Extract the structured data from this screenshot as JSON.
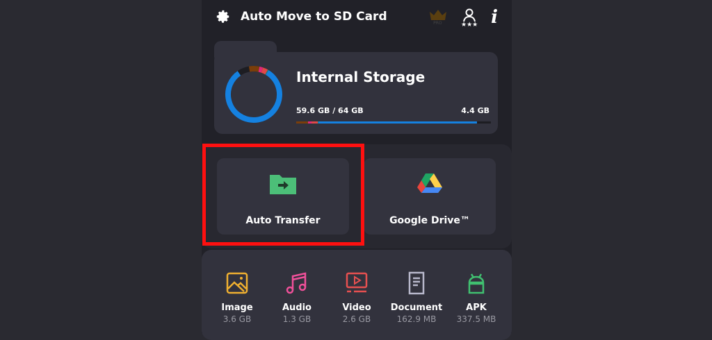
{
  "header": {
    "title": "Auto Move to SD Card",
    "pro_badge": "PRO",
    "icons": [
      "gear-icon",
      "crown-icon",
      "rate-icon",
      "info-icon"
    ]
  },
  "storage": {
    "title": "Internal Storage",
    "used": "59.6 GB / 64 GB",
    "free": "4.4 GB",
    "used_fraction": 0.93,
    "segments": [
      {
        "color": "#7a3e0a",
        "frac": 0.06
      },
      {
        "color": "#e0287a",
        "frac": 0.02
      },
      {
        "color": "#e04848",
        "frac": 0.03
      },
      {
        "color": "#1a8a7a",
        "frac": 0.005
      },
      {
        "color": "#1581e0",
        "frac": 0.815
      }
    ]
  },
  "actions": [
    {
      "label": "Auto Transfer"
    },
    {
      "label": "Google Drive™"
    }
  ],
  "categories": [
    {
      "label": "Image",
      "size": "3.6 GB",
      "color": "#f0b030"
    },
    {
      "label": "Audio",
      "size": "1.3 GB",
      "color": "#f0509a"
    },
    {
      "label": "Video",
      "size": "2.6 GB",
      "color": "#e85050"
    },
    {
      "label": "Document",
      "size": "162.9 MB",
      "color": "#b8b8cc"
    },
    {
      "label": "APK",
      "size": "337.5 MB",
      "color": "#40c070"
    }
  ]
}
